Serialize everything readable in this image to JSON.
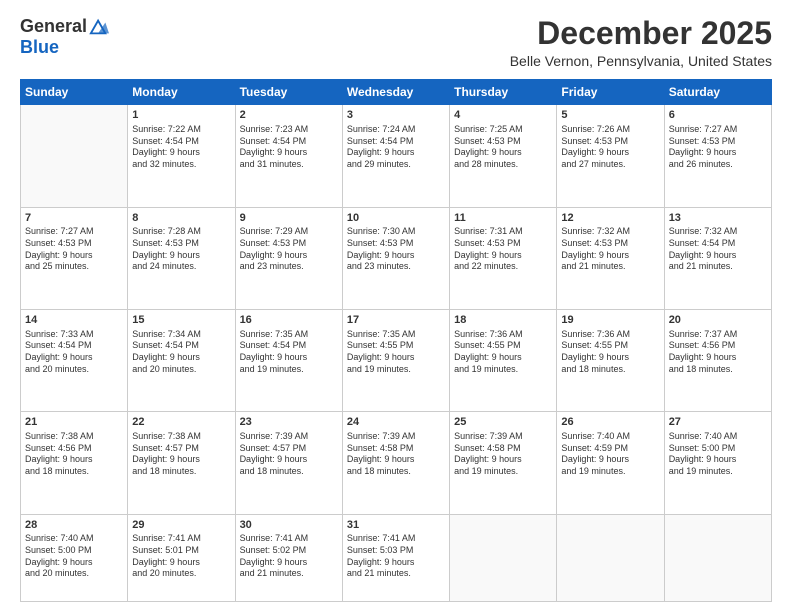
{
  "logo": {
    "general": "General",
    "blue": "Blue"
  },
  "header": {
    "month": "December 2025",
    "location": "Belle Vernon, Pennsylvania, United States"
  },
  "days_of_week": [
    "Sunday",
    "Monday",
    "Tuesday",
    "Wednesday",
    "Thursday",
    "Friday",
    "Saturday"
  ],
  "weeks": [
    [
      {
        "day": "",
        "info": ""
      },
      {
        "day": "1",
        "info": "Sunrise: 7:22 AM\nSunset: 4:54 PM\nDaylight: 9 hours\nand 32 minutes."
      },
      {
        "day": "2",
        "info": "Sunrise: 7:23 AM\nSunset: 4:54 PM\nDaylight: 9 hours\nand 31 minutes."
      },
      {
        "day": "3",
        "info": "Sunrise: 7:24 AM\nSunset: 4:54 PM\nDaylight: 9 hours\nand 29 minutes."
      },
      {
        "day": "4",
        "info": "Sunrise: 7:25 AM\nSunset: 4:53 PM\nDaylight: 9 hours\nand 28 minutes."
      },
      {
        "day": "5",
        "info": "Sunrise: 7:26 AM\nSunset: 4:53 PM\nDaylight: 9 hours\nand 27 minutes."
      },
      {
        "day": "6",
        "info": "Sunrise: 7:27 AM\nSunset: 4:53 PM\nDaylight: 9 hours\nand 26 minutes."
      }
    ],
    [
      {
        "day": "7",
        "info": "Sunrise: 7:27 AM\nSunset: 4:53 PM\nDaylight: 9 hours\nand 25 minutes."
      },
      {
        "day": "8",
        "info": "Sunrise: 7:28 AM\nSunset: 4:53 PM\nDaylight: 9 hours\nand 24 minutes."
      },
      {
        "day": "9",
        "info": "Sunrise: 7:29 AM\nSunset: 4:53 PM\nDaylight: 9 hours\nand 23 minutes."
      },
      {
        "day": "10",
        "info": "Sunrise: 7:30 AM\nSunset: 4:53 PM\nDaylight: 9 hours\nand 23 minutes."
      },
      {
        "day": "11",
        "info": "Sunrise: 7:31 AM\nSunset: 4:53 PM\nDaylight: 9 hours\nand 22 minutes."
      },
      {
        "day": "12",
        "info": "Sunrise: 7:32 AM\nSunset: 4:53 PM\nDaylight: 9 hours\nand 21 minutes."
      },
      {
        "day": "13",
        "info": "Sunrise: 7:32 AM\nSunset: 4:54 PM\nDaylight: 9 hours\nand 21 minutes."
      }
    ],
    [
      {
        "day": "14",
        "info": "Sunrise: 7:33 AM\nSunset: 4:54 PM\nDaylight: 9 hours\nand 20 minutes."
      },
      {
        "day": "15",
        "info": "Sunrise: 7:34 AM\nSunset: 4:54 PM\nDaylight: 9 hours\nand 20 minutes."
      },
      {
        "day": "16",
        "info": "Sunrise: 7:35 AM\nSunset: 4:54 PM\nDaylight: 9 hours\nand 19 minutes."
      },
      {
        "day": "17",
        "info": "Sunrise: 7:35 AM\nSunset: 4:55 PM\nDaylight: 9 hours\nand 19 minutes."
      },
      {
        "day": "18",
        "info": "Sunrise: 7:36 AM\nSunset: 4:55 PM\nDaylight: 9 hours\nand 19 minutes."
      },
      {
        "day": "19",
        "info": "Sunrise: 7:36 AM\nSunset: 4:55 PM\nDaylight: 9 hours\nand 18 minutes."
      },
      {
        "day": "20",
        "info": "Sunrise: 7:37 AM\nSunset: 4:56 PM\nDaylight: 9 hours\nand 18 minutes."
      }
    ],
    [
      {
        "day": "21",
        "info": "Sunrise: 7:38 AM\nSunset: 4:56 PM\nDaylight: 9 hours\nand 18 minutes."
      },
      {
        "day": "22",
        "info": "Sunrise: 7:38 AM\nSunset: 4:57 PM\nDaylight: 9 hours\nand 18 minutes."
      },
      {
        "day": "23",
        "info": "Sunrise: 7:39 AM\nSunset: 4:57 PM\nDaylight: 9 hours\nand 18 minutes."
      },
      {
        "day": "24",
        "info": "Sunrise: 7:39 AM\nSunset: 4:58 PM\nDaylight: 9 hours\nand 18 minutes."
      },
      {
        "day": "25",
        "info": "Sunrise: 7:39 AM\nSunset: 4:58 PM\nDaylight: 9 hours\nand 19 minutes."
      },
      {
        "day": "26",
        "info": "Sunrise: 7:40 AM\nSunset: 4:59 PM\nDaylight: 9 hours\nand 19 minutes."
      },
      {
        "day": "27",
        "info": "Sunrise: 7:40 AM\nSunset: 5:00 PM\nDaylight: 9 hours\nand 19 minutes."
      }
    ],
    [
      {
        "day": "28",
        "info": "Sunrise: 7:40 AM\nSunset: 5:00 PM\nDaylight: 9 hours\nand 20 minutes."
      },
      {
        "day": "29",
        "info": "Sunrise: 7:41 AM\nSunset: 5:01 PM\nDaylight: 9 hours\nand 20 minutes."
      },
      {
        "day": "30",
        "info": "Sunrise: 7:41 AM\nSunset: 5:02 PM\nDaylight: 9 hours\nand 21 minutes."
      },
      {
        "day": "31",
        "info": "Sunrise: 7:41 AM\nSunset: 5:03 PM\nDaylight: 9 hours\nand 21 minutes."
      },
      {
        "day": "",
        "info": ""
      },
      {
        "day": "",
        "info": ""
      },
      {
        "day": "",
        "info": ""
      }
    ]
  ]
}
